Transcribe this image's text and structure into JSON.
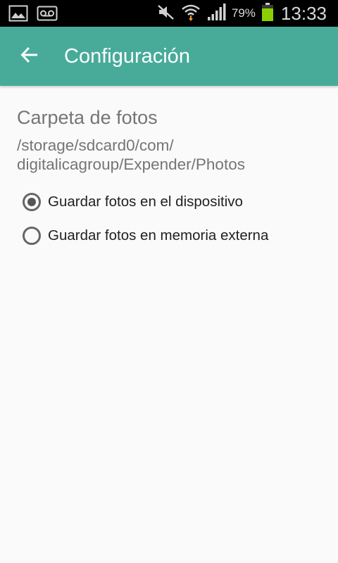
{
  "status_bar": {
    "battery_percent": "79%",
    "time": "13:33",
    "icons": [
      "gallery-icon",
      "voicemail-icon",
      "mute-icon",
      "wifi-icon",
      "signal-icon",
      "battery-icon"
    ]
  },
  "app_bar": {
    "back_icon": "back-arrow-icon",
    "title": "Configuración",
    "color": "#48ab9a"
  },
  "settings": {
    "section_title": "Carpeta de fotos",
    "folder_path": "/storage/sdcard0/com/\ndigitalicagroup/Expender/Photos",
    "options": [
      {
        "label": "Guardar fotos en el dispositivo",
        "selected": true
      },
      {
        "label": "Guardar fotos en memoria externa",
        "selected": false
      }
    ]
  }
}
